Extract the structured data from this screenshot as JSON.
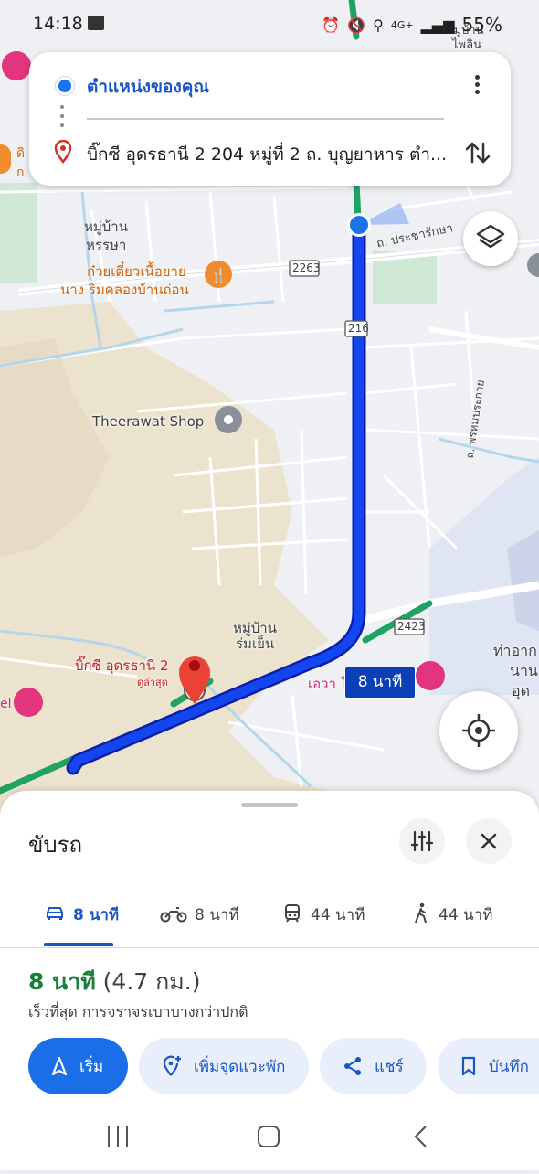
{
  "status_bar": {
    "time": "14:18",
    "network": "4G+",
    "battery": "55%"
  },
  "route_card": {
    "origin": "ตำแหน่งของคุณ",
    "destination": "บิ๊กซี อุดรธานี 2 204 หมู่ที่ 2 ถ. บุญยาหาร ตำ...",
    "origin_icon": "blue-dot-icon",
    "destination_icon": "location-pin-icon",
    "more_icon": "more-vert-icon",
    "swap_icon": "swap-vert-icon"
  },
  "map": {
    "labels": {
      "village_hansaa_1": "หมู่บ้าน",
      "village_hansaa_2": "หรรษา",
      "noodle_1": "ก๋วยเตี๋ยวเนื้อยาย",
      "noodle_2": "นาง ริมคลองบ้านถ่อน",
      "road_2263": "2263",
      "road_216": "216",
      "road_2423": "2423",
      "road_prachaaraksa": "ถ. ประชารักษา",
      "road_phrommaprakai": "ถ. พรหมประกาย",
      "theerawat": "Theerawat Shop",
      "village_romyen_1": "หมู่บ้าน",
      "village_romyen_2": "ร่มเย็น",
      "bigc_label": "บิ๊กซี อุดรธานี 2",
      "bigc_sub": "ดูล่าสุด",
      "evagrand": "เอวา โ",
      "airport_1": "ท่าอาก",
      "airport_2": "นาน",
      "airport_3": "อุด",
      "top_village_1": "หมู่บ้าน",
      "top_village_2": "ไพลิน",
      "left_edge_1": "ดิ",
      "left_edge_2": "ก",
      "left_hotel": "el"
    },
    "route_time_badge": "8 นาที",
    "layers_icon": "layers-icon",
    "locate_icon": "my-location-icon"
  },
  "sheet": {
    "title": "ขับรถ",
    "options_icon": "tune-icon",
    "close_icon": "close-icon",
    "modes": [
      {
        "icon": "car-icon",
        "label": "8 นาที",
        "active": true
      },
      {
        "icon": "motorcycle-icon",
        "label": "8 นาที",
        "active": false
      },
      {
        "icon": "transit-icon",
        "label": "44 นาที",
        "active": false
      },
      {
        "icon": "walk-icon",
        "label": "44 นาที",
        "active": false
      }
    ],
    "summary_time": "8 นาที",
    "summary_distance": "(4.7 กม.)",
    "summary_note": "เร็วที่สุด การจราจรเบาบางกว่าปกติ",
    "actions": [
      {
        "icon": "navigation-arrow-icon",
        "label": "เริ่ม"
      },
      {
        "icon": "add-stop-icon",
        "label": "เพิ่มจุดแวะพัก"
      },
      {
        "icon": "share-icon",
        "label": "แชร์"
      },
      {
        "icon": "bookmark-icon",
        "label": "บันทึก"
      }
    ]
  },
  "colors": {
    "route_blue": "#0b2fd6",
    "accent_blue": "#1a56c8",
    "primary_button": "#1a6ee8",
    "traffic_green": "#1ea362",
    "summary_green": "#188038",
    "pin_red": "#ea4335"
  }
}
